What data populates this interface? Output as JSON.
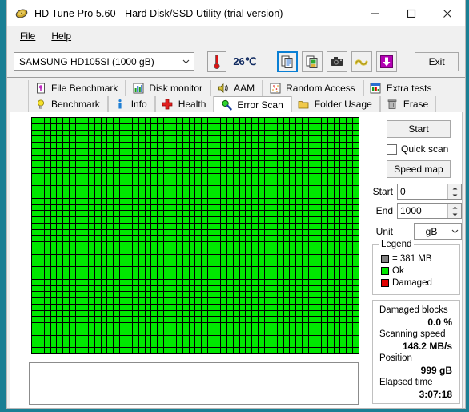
{
  "window": {
    "title": "HD Tune Pro 5.60 - Hard Disk/SSD Utility (trial version)",
    "icon": "hard-disk-icon",
    "minimize": "—",
    "maximize": "□",
    "close": "✕"
  },
  "menu": {
    "items": [
      {
        "label": "File",
        "accel": "F"
      },
      {
        "label": "Help",
        "accel": "H"
      }
    ]
  },
  "toolbar": {
    "drive": "SAMSUNG HD105SI (1000 gB)",
    "temperature": "26℃",
    "temp_icon": "thermometer-icon",
    "icons": [
      {
        "name": "copy-icon",
        "focused": true
      },
      {
        "name": "copy-image-icon",
        "focused": false
      },
      {
        "name": "camera-icon",
        "focused": false
      },
      {
        "name": "folder-cable-icon",
        "focused": false
      },
      {
        "name": "download-arrow-icon",
        "focused": false
      }
    ],
    "exit_label": "Exit"
  },
  "tabs": {
    "row1": [
      {
        "label": "File Benchmark",
        "icon": "file-benchmark-icon",
        "active": false
      },
      {
        "label": "Disk monitor",
        "icon": "bar-chart-icon",
        "active": false
      },
      {
        "label": "AAM",
        "icon": "speaker-icon",
        "active": false
      },
      {
        "label": "Random Access",
        "icon": "scatter-icon",
        "active": false
      },
      {
        "label": "Extra tests",
        "icon": "extra-tests-icon",
        "active": false
      }
    ],
    "row2": [
      {
        "label": "Benchmark",
        "icon": "bulb-icon",
        "active": false
      },
      {
        "label": "Info",
        "icon": "info-icon",
        "active": false
      },
      {
        "label": "Health",
        "icon": "cross-icon",
        "active": false
      },
      {
        "label": "Error Scan",
        "icon": "magnifier-icon",
        "active": true
      },
      {
        "label": "Folder Usage",
        "icon": "folder-icon",
        "active": false
      },
      {
        "label": "Erase",
        "icon": "trash-icon",
        "active": false
      }
    ]
  },
  "scan": {
    "columns": 52,
    "rows": 38,
    "ok_color": "#00e800",
    "damaged_color": "#e00000",
    "grid_background": "#000000",
    "log_text": ""
  },
  "controls": {
    "start_label": "Start",
    "quick_scan_label": "Quick scan",
    "quick_scan_checked": false,
    "speed_map_label": "Speed map",
    "start_field_label": "Start",
    "start_field_value": "0",
    "end_field_label": "End",
    "end_field_value": "1000",
    "unit_label": "Unit",
    "unit_value": "gB"
  },
  "legend": {
    "title": "Legend",
    "block_size": "= 381 MB",
    "ok_label": "Ok",
    "damaged_label": "Damaged"
  },
  "stats": {
    "damaged_blocks_label": "Damaged blocks",
    "damaged_blocks_value": "0.0 %",
    "scanning_speed_label": "Scanning speed",
    "scanning_speed_value": "148.2 MB/s",
    "position_label": "Position",
    "position_value": "999 gB",
    "elapsed_time_label": "Elapsed time",
    "elapsed_time_value": "3:07:18"
  }
}
